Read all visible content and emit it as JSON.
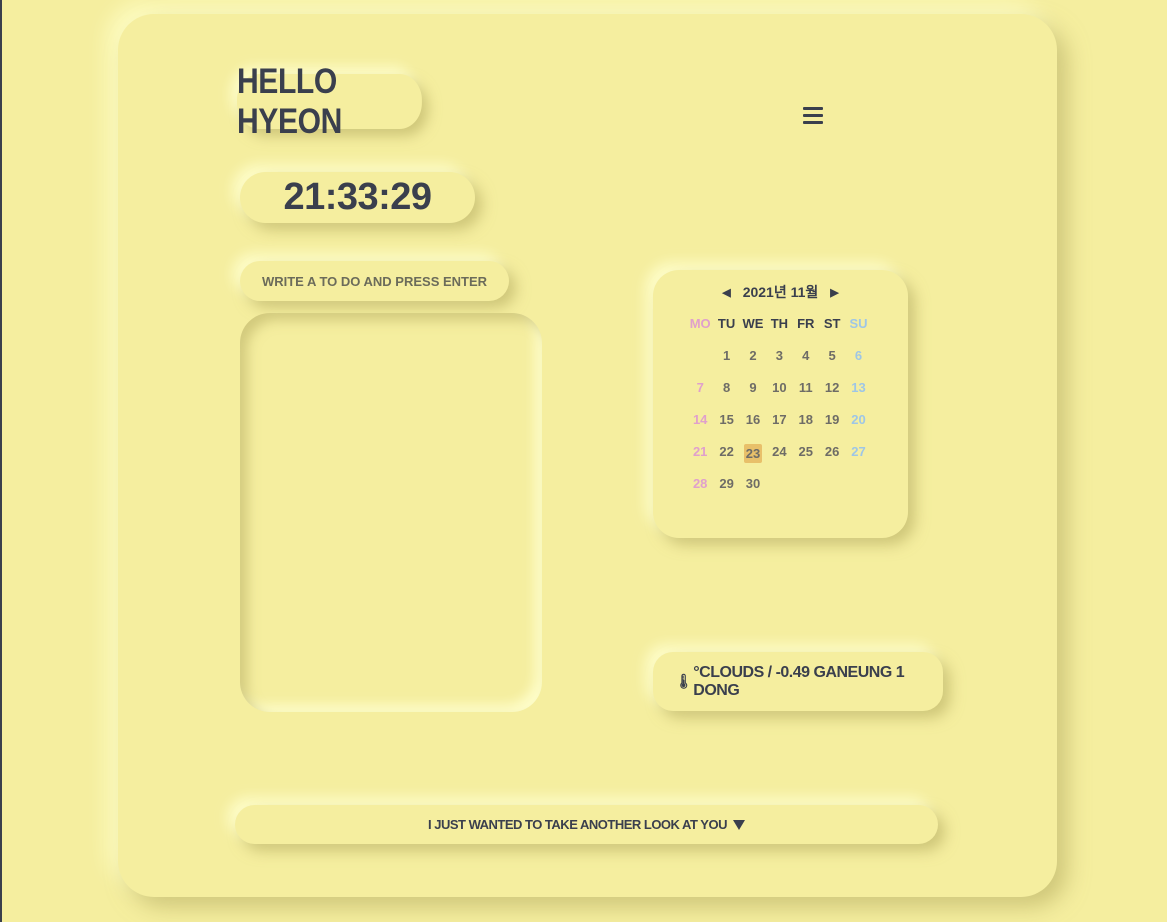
{
  "greeting": "Hello Hyeon",
  "clock": "21:33:29",
  "todo": {
    "placeholder": "Write a to do and press enter"
  },
  "menu_icon": "hamburger-menu-icon",
  "calendar": {
    "title": "2021년 11월",
    "weekdays": [
      "MO",
      "TU",
      "WE",
      "TH",
      "FR",
      "ST",
      "SU"
    ],
    "weeks": [
      [
        "",
        "1",
        "2",
        "3",
        "4",
        "5",
        "6"
      ],
      [
        "7",
        "8",
        "9",
        "10",
        "11",
        "12",
        "13"
      ],
      [
        "14",
        "15",
        "16",
        "17",
        "18",
        "19",
        "20"
      ],
      [
        "21",
        "22",
        "23",
        "24",
        "25",
        "26",
        "27"
      ],
      [
        "28",
        "29",
        "30",
        "",
        "",
        "",
        ""
      ]
    ],
    "today": "23",
    "colors": {
      "monday": "#e0a0cc",
      "sunday": "#9ec6e6",
      "today_bg": "#e8c06a"
    }
  },
  "weather": {
    "icon": "thermometer-icon",
    "text": "°Clouds / -0.49  Ganeung 1 Dong"
  },
  "music": {
    "label": "I just wanted to take another look at you",
    "icon": "play-triangle-icon"
  },
  "colors": {
    "background": "#f5ee9f",
    "text": "#3a3f4d"
  }
}
